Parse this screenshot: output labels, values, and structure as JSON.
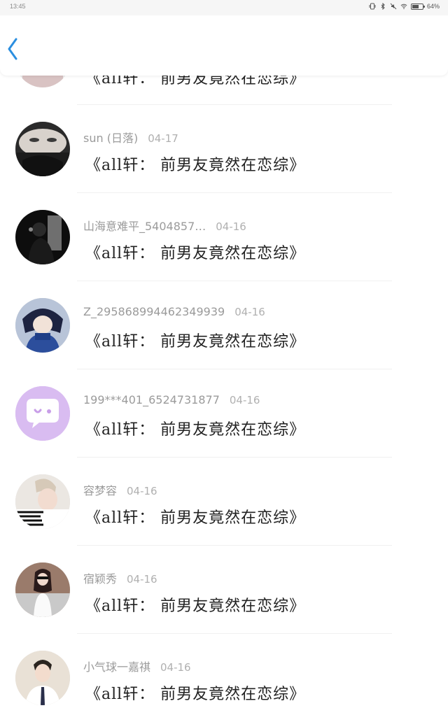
{
  "status_bar": {
    "time": "13:45",
    "battery": "64%",
    "battery_level": 0.64
  },
  "header": {
    "back_icon": "chevron-left-icon",
    "accent": "#2b8fe0"
  },
  "list": {
    "partial_title": "《all轩： 前男友竟然在恋综》",
    "items": [
      {
        "username": "sun (日落)",
        "date": "04-17",
        "title": "《all轩： 前男友竟然在恋综》",
        "avatar": "dark-portrait"
      },
      {
        "username": "山海意难平_5404857…",
        "date": "04-16",
        "title": "《all轩： 前男友竟然在恋综》",
        "avatar": "silhouette-photo"
      },
      {
        "username": "Z_295868994462349939",
        "date": "04-16",
        "title": "《all轩： 前男友竟然在恋综》",
        "avatar": "anime-blue"
      },
      {
        "username": "199***401_6524731877",
        "date": "04-16",
        "title": "《all轩： 前男友竟然在恋综》",
        "avatar": "purple-chat-bubble"
      },
      {
        "username": "容梦容",
        "date": "04-16",
        "title": "《all轩： 前男友竟然在恋综》",
        "avatar": "striped-portrait"
      },
      {
        "username": "宿颖秀",
        "date": "04-16",
        "title": "《all轩： 前男友竟然在恋综》",
        "avatar": "woman-photo"
      },
      {
        "username": "小气球一嘉祺",
        "date": "04-16",
        "title": "《all轩： 前男友竟然在恋综》",
        "avatar": "man-suit"
      }
    ]
  }
}
